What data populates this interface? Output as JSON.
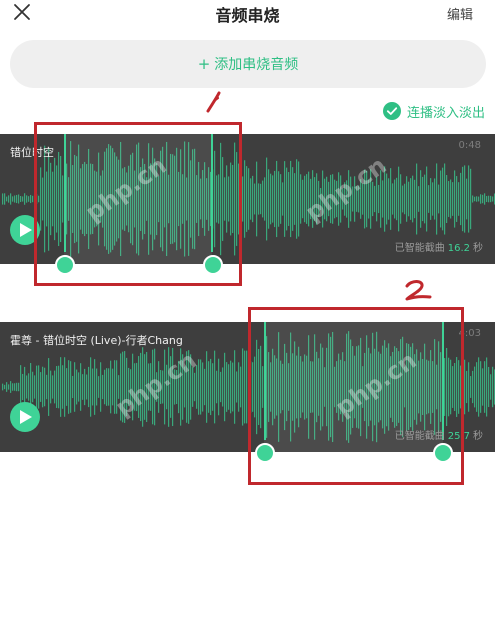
{
  "header": {
    "title": "音频串烧",
    "edit_label": "编辑"
  },
  "add_bar": {
    "plus": "+",
    "label": "添加串烧音频"
  },
  "crossfade": {
    "label": "连播淡入淡出",
    "checked": true
  },
  "tracks": [
    {
      "name": "错位时空",
      "duration": "0:48",
      "smart_cut_prefix": "已智能截曲",
      "smart_cut_value": "16.2",
      "smart_cut_unit": "秒"
    },
    {
      "name": "霍尊 - 错位时空 (Live)-行者Chang",
      "duration": "4:03",
      "smart_cut_prefix": "已智能截曲",
      "smart_cut_value": "25.7",
      "smart_cut_unit": "秒"
    }
  ],
  "annotations": [
    "1",
    "2"
  ],
  "watermark": "php.cn",
  "colors": {
    "accent": "#3fd397",
    "accent_text": "#2fbf84",
    "track_bg": "#3e3e3e",
    "annotation": "#c0282d"
  }
}
